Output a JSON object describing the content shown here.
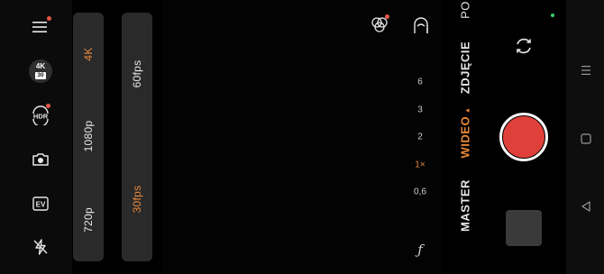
{
  "left_toolbar": {
    "menu_icon": "menu-icon",
    "resolution_badge": {
      "top": "4K",
      "bottom": "30"
    },
    "hdr_label": "HDR",
    "camera_icon": "camera-icon",
    "ev_label": "EV",
    "flash_icon": "flash-off-icon"
  },
  "resolution_options": [
    "4K",
    "1080p",
    "720p"
  ],
  "resolution_selected": "4K",
  "fps_options": [
    "60fps",
    "30fps"
  ],
  "fps_selected": "30fps",
  "top_icons": {
    "filter_icon": "filters-icon",
    "beauty_icon": "face-retouch-icon"
  },
  "zoom_levels": [
    "6",
    "3",
    "2",
    "1×",
    "0,6"
  ],
  "zoom_selected": "1×",
  "aperture_label": "ƒ",
  "modes": [
    "PO",
    "ZDJĘCIE",
    "WIDEO",
    "MASTER"
  ],
  "mode_active": "WIDEO",
  "mode_caret": "▲",
  "accent_color": "#e8883a",
  "record_color": "#e0403a"
}
